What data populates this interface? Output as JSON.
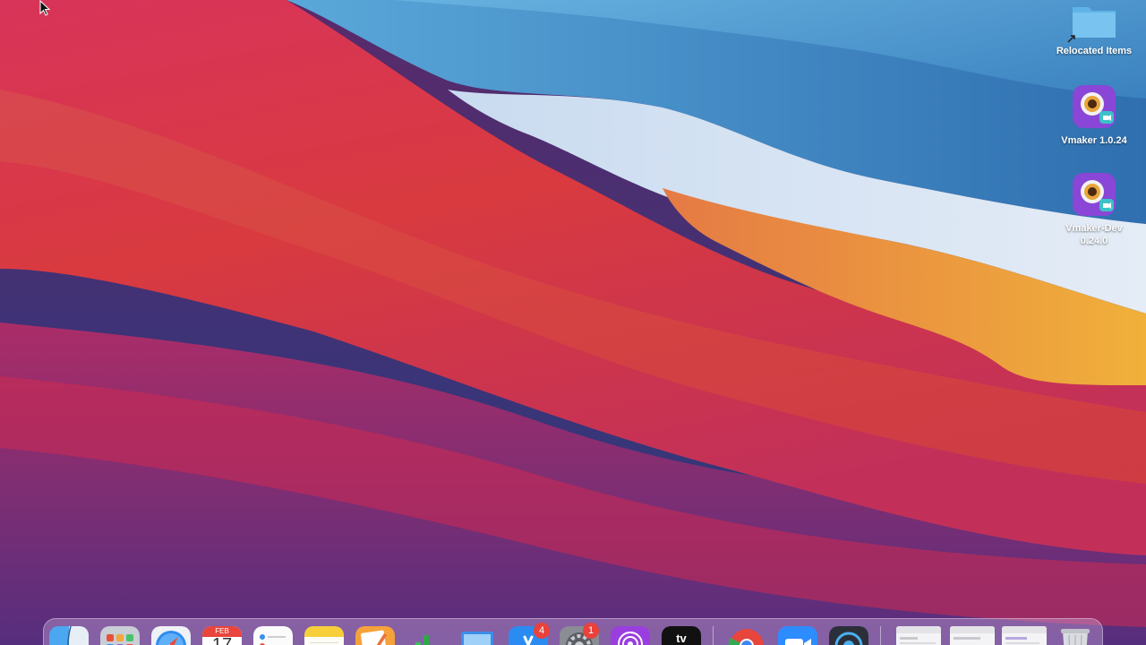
{
  "desktop": {
    "icons": [
      {
        "label": "Relocated Items",
        "icon": "folder-icon"
      },
      {
        "label": "Vmaker 1.0.24",
        "icon": "vmaker-app-icon"
      },
      {
        "label": "Vmaker-Dev\n0.24.0",
        "icon": "vmaker-app-icon"
      }
    ]
  },
  "dock": {
    "calendar": {
      "month": "FEB",
      "day": "17"
    },
    "tv": {
      "text": "tv"
    },
    "items": [
      {
        "name": "finder",
        "icon": "finder-icon"
      },
      {
        "name": "launchpad",
        "icon": "launchpad-icon"
      },
      {
        "name": "safari",
        "icon": "safari-icon"
      },
      {
        "name": "calendar",
        "icon": "calendar-icon"
      },
      {
        "name": "reminders",
        "icon": "reminders-icon"
      },
      {
        "name": "notes",
        "icon": "notes-icon"
      },
      {
        "name": "pages",
        "icon": "pages-icon"
      },
      {
        "name": "numbers",
        "icon": "numbers-icon"
      },
      {
        "name": "keynote",
        "icon": "keynote-icon"
      },
      {
        "name": "app-store",
        "icon": "app-store-icon",
        "badge": "4"
      },
      {
        "name": "system-preferences",
        "icon": "gear-icon",
        "badge": "1"
      },
      {
        "name": "podcasts",
        "icon": "podcasts-icon"
      },
      {
        "name": "apple-tv",
        "icon": "apple-tv-icon"
      },
      {
        "name": "chrome",
        "icon": "chrome-icon"
      },
      {
        "name": "zoom",
        "icon": "zoom-icon"
      },
      {
        "name": "proxyman",
        "icon": "network-icon"
      },
      {
        "name": "minimized-window-1",
        "icon": "window-thumbnail-icon"
      },
      {
        "name": "minimized-window-2",
        "icon": "window-thumbnail-icon"
      },
      {
        "name": "minimized-window-3",
        "icon": "window-thumbnail-icon"
      },
      {
        "name": "trash",
        "icon": "trash-icon"
      }
    ]
  },
  "colors": {
    "wallpaper_red": "#d7263d",
    "wallpaper_blue": "#3a86c0",
    "wallpaper_orange": "#e8973a",
    "wallpaper_purple": "#5a2d7e",
    "badge_red": "#e8423b"
  }
}
